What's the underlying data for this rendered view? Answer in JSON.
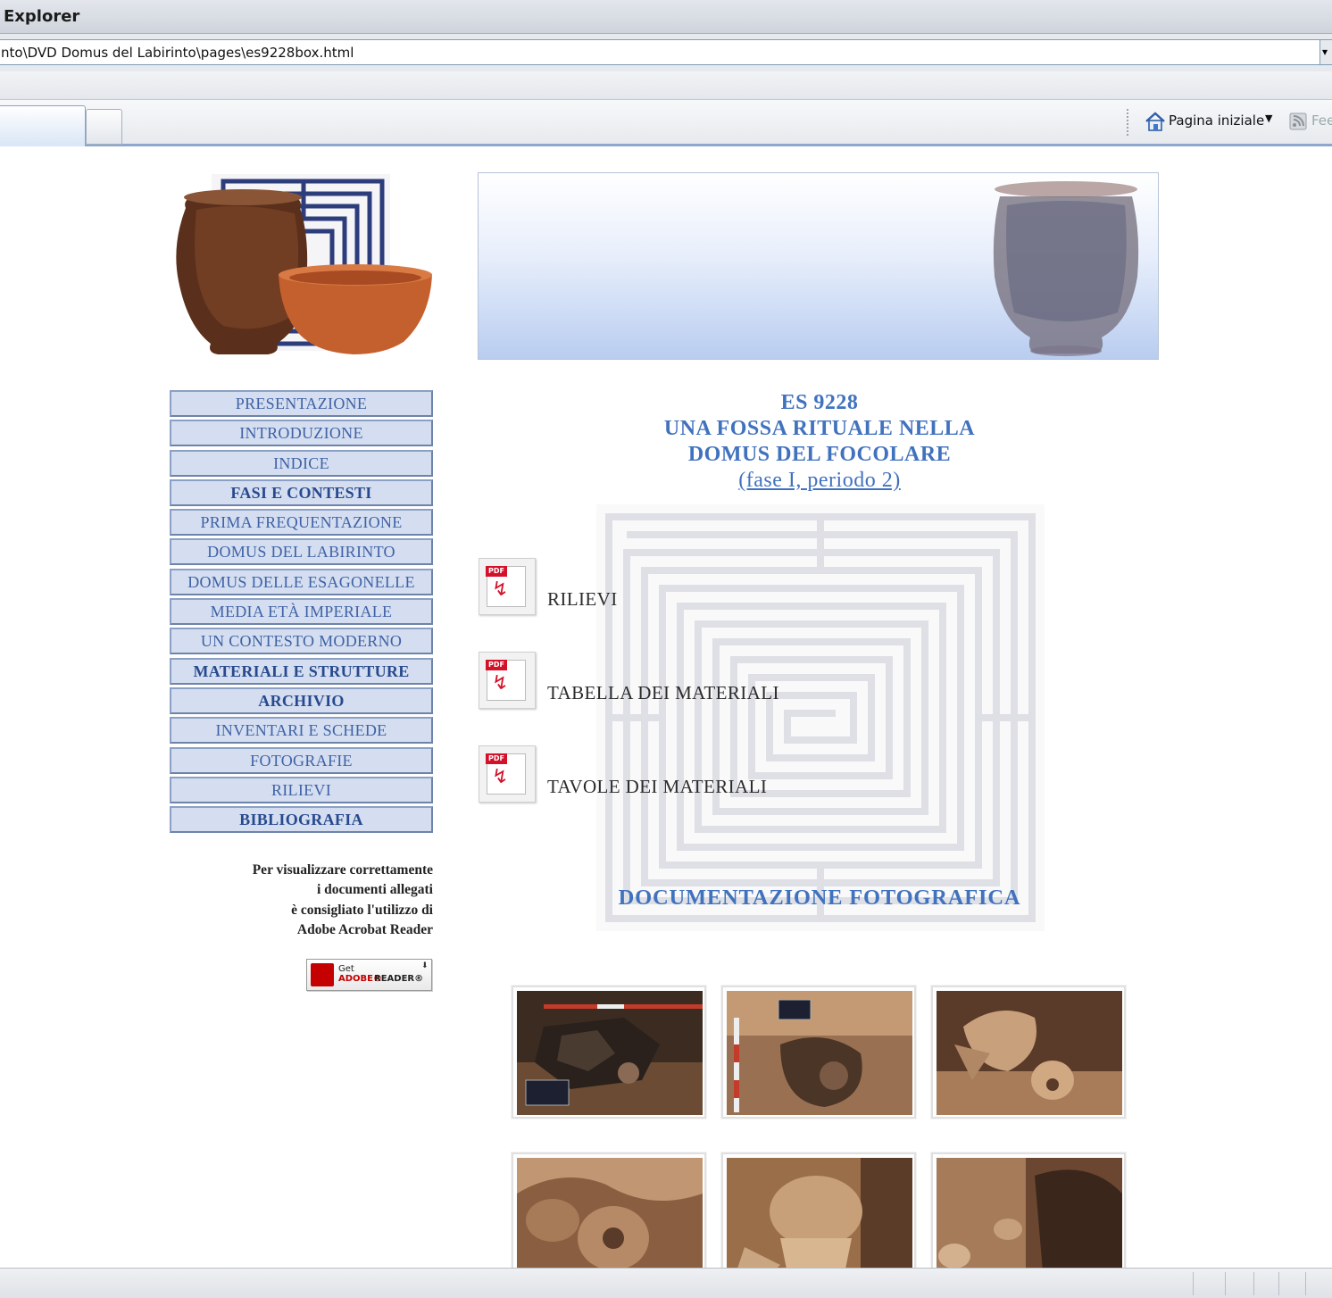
{
  "browser": {
    "title": "Explorer",
    "address": "nto\\DVD Domus del Labirinto\\pages\\es9228box.html",
    "home_label": "Pagina iniziale",
    "feed_label": "Fee"
  },
  "nav": {
    "items": [
      {
        "label": "PRESENTAZIONE",
        "bold": false
      },
      {
        "label": "INTRODUZIONE",
        "bold": false
      },
      {
        "label": "INDICE",
        "bold": false
      },
      {
        "label": "FASI E CONTESTI",
        "bold": true
      },
      {
        "label": "PRIMA FREQUENTAZIONE",
        "bold": false
      },
      {
        "label": "DOMUS DEL LABIRINTO",
        "bold": false
      },
      {
        "label": "DOMUS DELLE ESAGONELLE",
        "bold": false
      },
      {
        "label": "MEDIA ETÀ IMPERIALE",
        "bold": false
      },
      {
        "label": "UN CONTESTO MODERNO",
        "bold": false
      },
      {
        "label": "MATERIALI E STRUTTURE",
        "bold": true
      },
      {
        "label": "ARCHIVIO",
        "bold": true
      },
      {
        "label": "INVENTARI E SCHEDE",
        "bold": false
      },
      {
        "label": "FOTOGRAFIE",
        "bold": false
      },
      {
        "label": "RILIEVI",
        "bold": false
      },
      {
        "label": "BIBLIOGRAFIA",
        "bold": true
      }
    ]
  },
  "reader_note": {
    "line1": "Per visualizzare correttamente",
    "line2": "i documenti allegati",
    "line3": "è consigliato l'utilizzo di",
    "line4": "Adobe Acrobat Reader"
  },
  "reader_badge": {
    "get": "Get",
    "adobe": "ADOBE®",
    "reader": "READER®"
  },
  "headline": {
    "line1": "ES 9228",
    "line2": "UNA FOSSA RITUALE NELLA",
    "line3": "DOMUS DEL FOCOLARE",
    "link": "(fase I, periodo 2)"
  },
  "documents": [
    {
      "label": "RILIEVI"
    },
    {
      "label": "TABELLA DEI MATERIALI"
    },
    {
      "label": "TAVOLE DEI MATERIALI"
    }
  ],
  "pdf_tag": "PDF",
  "photo_heading": "DOCUMENTAZIONE FOTOGRAFICA",
  "colors": {
    "accent": "#4172be",
    "nav_bg": "#d4def0",
    "nav_border": "#8ba0c4",
    "pdf_red": "#d4112a"
  }
}
